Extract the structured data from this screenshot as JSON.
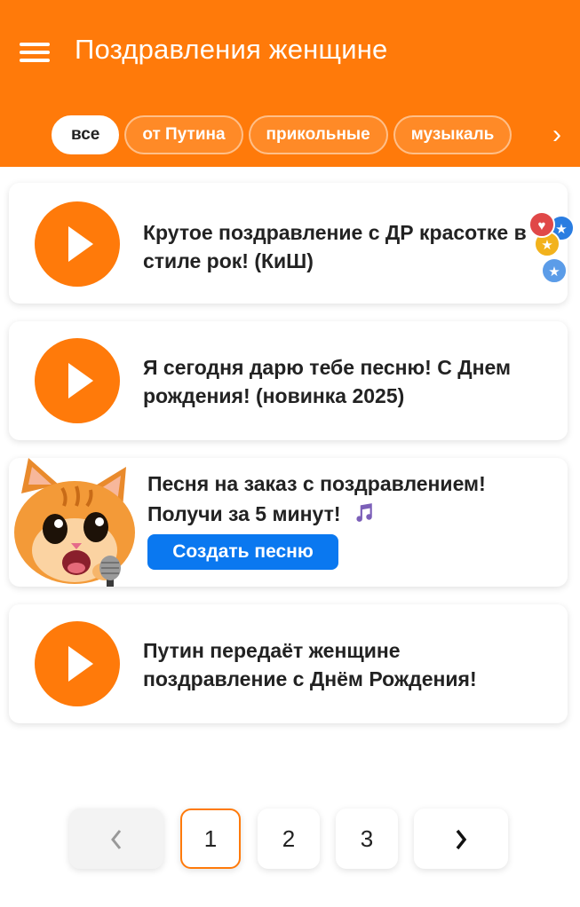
{
  "header": {
    "title": "Поздравления женщине",
    "menu_icon": "hamburger-menu-icon",
    "background": "#ff7a0a"
  },
  "filters": {
    "chips": [
      {
        "label": "все",
        "active": true
      },
      {
        "label": "от Путина",
        "active": false
      },
      {
        "label": "прикольные",
        "active": false
      },
      {
        "label": "музыкаль",
        "active": false
      }
    ],
    "next_icon": "chevron-right-icon"
  },
  "items": [
    {
      "title": "Крутое поздравление с ДР красотке в стиле рок! (КиШ)"
    },
    {
      "title": "Я сегодня дарю тебе песню! С Днем рождения! (новинка 2025)"
    },
    {
      "title": "Путин передаёт женщине поздравление с Днём Рождения!"
    }
  ],
  "promo": {
    "line1": "Песня на заказ с поздравлением!",
    "line2": "Получи за 5 минут!",
    "button_label": "Создать песню",
    "music_icon": "music-note-icon",
    "image": "singing-cat-illustration"
  },
  "pagination": {
    "prev_icon": "chevron-left-icon",
    "pages": [
      "1",
      "2",
      "3"
    ],
    "current": "1",
    "next_icon": "chevron-right-icon"
  },
  "colors": {
    "accent": "#ff7a0a",
    "button": "#0a78f0"
  }
}
